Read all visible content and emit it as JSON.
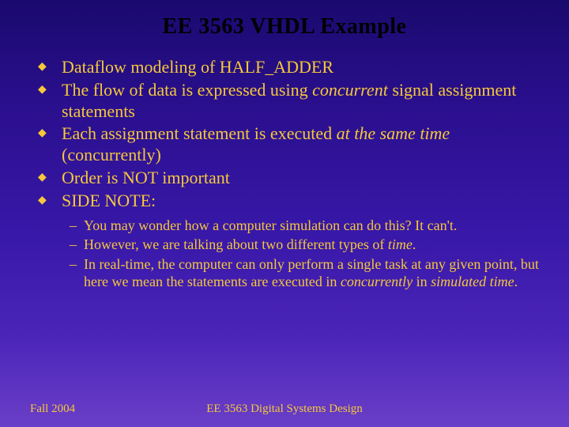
{
  "title": "EE 3563 VHDL Example",
  "bullets": {
    "b1": "Dataflow modeling of HALF_ADDER",
    "b2a": "The flow of data is expressed using ",
    "b2b": "concurrent",
    "b2c": " signal assignment statements",
    "b3a": "Each assignment statement is executed ",
    "b3b": "at the same time",
    "b3c": " (concurrently)",
    "b4": "Order is NOT important",
    "b5": "SIDE NOTE:"
  },
  "subbullets": {
    "s1": "You may wonder how a computer simulation can do this?  It can't.",
    "s2a": "However, we are talking about two different types of ",
    "s2b": "time",
    "s2c": ".",
    "s3a": "In real-time, the computer can only perform a single task at any given point, but here we mean the statements are executed in ",
    "s3b": "concurrently",
    "s3c": " in ",
    "s3d": "simulated time",
    "s3e": "."
  },
  "footer": {
    "left": "Fall 2004",
    "center": "EE 3563 Digital Systems Design"
  }
}
